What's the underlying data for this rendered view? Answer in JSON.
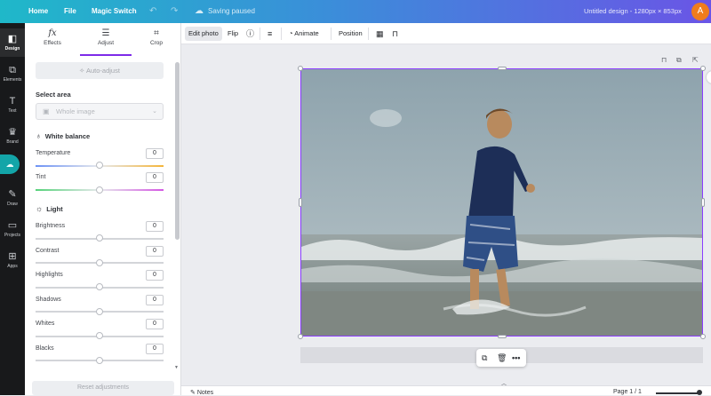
{
  "topbar": {
    "home": "Home",
    "file": "File",
    "magic_switch": "Magic Switch",
    "undo_icon": "undo-icon",
    "redo_icon": "redo-icon",
    "saving_status": "Saving paused",
    "doc_title": "Untitled design - 1280px × 853px",
    "avatar_initial": "A"
  },
  "rail": {
    "items": [
      {
        "label": "Design",
        "icon": "design-icon"
      },
      {
        "label": "Elements",
        "icon": "elements-icon"
      },
      {
        "label": "Text",
        "icon": "text-icon"
      },
      {
        "label": "Brand",
        "icon": "brand-icon"
      },
      {
        "label": "",
        "icon": "upload-icon"
      },
      {
        "label": "Draw",
        "icon": "draw-icon"
      },
      {
        "label": "Projects",
        "icon": "projects-icon"
      },
      {
        "label": "Apps",
        "icon": "apps-icon"
      }
    ]
  },
  "panel": {
    "tabs": [
      {
        "label": "Effects",
        "icon": "fx"
      },
      {
        "label": "Adjust",
        "icon": "sliders"
      },
      {
        "label": "Crop",
        "icon": "crop"
      }
    ],
    "auto_adjust": "Auto-adjust",
    "select_area_label": "Select area",
    "select_area_value": "Whole image",
    "white_balance": "White balance",
    "light": "Light",
    "sliders": {
      "temperature": {
        "label": "Temperature",
        "value": "0"
      },
      "tint": {
        "label": "Tint",
        "value": "0"
      },
      "brightness": {
        "label": "Brightness",
        "value": "0"
      },
      "contrast": {
        "label": "Contrast",
        "value": "0"
      },
      "highlights": {
        "label": "Highlights",
        "value": "0"
      },
      "shadows": {
        "label": "Shadows",
        "value": "0"
      },
      "whites": {
        "label": "Whites",
        "value": "0"
      },
      "blacks": {
        "label": "Blacks",
        "value": "0"
      }
    },
    "reset": "Reset adjustments"
  },
  "toolbar": {
    "edit_photo": "Edit photo",
    "flip": "Flip",
    "animate": "Animate",
    "position": "Position"
  },
  "footer": {
    "notes": "Notes",
    "page": "Page 1 / 1"
  },
  "colors": {
    "accent": "#7d2ae8",
    "selection": "#8b3dff"
  }
}
